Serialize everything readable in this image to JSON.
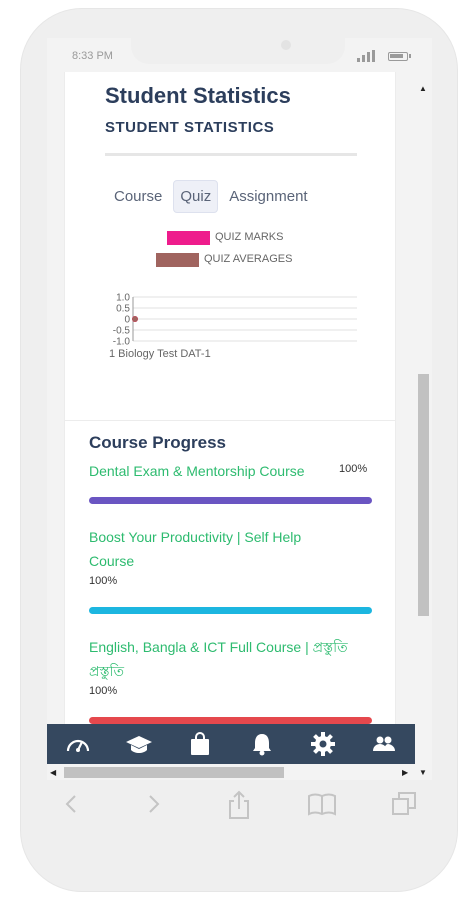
{
  "status_bar": {
    "time": "8:33 PM"
  },
  "stats_card": {
    "title": "Student Statistics",
    "subtitle": "STUDENT STATISTICS",
    "tabs": [
      {
        "label": "Course",
        "active": false
      },
      {
        "label": "Quiz",
        "active": true
      },
      {
        "label": "Assignment",
        "active": false
      }
    ]
  },
  "chart_data": {
    "type": "line",
    "legend": [
      {
        "label": "QUIZ MARKS",
        "color": "#ee1c8c"
      },
      {
        "label": "QUIZ AVERAGES",
        "color": "#a0645f"
      }
    ],
    "y_ticks": [
      "1.0",
      "0.5",
      "0",
      "-0.5",
      "-1.0"
    ],
    "ylim": [
      -1.0,
      1.0
    ],
    "categories": [
      "1 Biology Test DAT-1"
    ],
    "series": [
      {
        "name": "QUIZ MARKS",
        "values": [
          0
        ]
      },
      {
        "name": "QUIZ AVERAGES",
        "values": [
          0
        ]
      }
    ]
  },
  "progress_card": {
    "title": "Course Progress",
    "courses": [
      {
        "name": "Dental Exam & Mentorship Course",
        "percent_text": "100%",
        "progress": 1.0,
        "color": "#6a55c2"
      },
      {
        "name": "Boost Your Productivity | Self Help Course",
        "percent_text": "100%",
        "progress": 1.0,
        "color": "#1cb6e0"
      },
      {
        "name": "English, Bangla & ICT Full Course | প্রস্তুতি প্রস্তুতি",
        "percent_text": "100%",
        "progress": 1.0,
        "color": "#e5484d"
      }
    ]
  },
  "bottom_nav": {
    "icons": [
      "dashboard-gauge-icon",
      "graduation-cap-icon",
      "shopping-bag-icon",
      "bell-icon",
      "gear-icon",
      "users-icon"
    ]
  },
  "browser_bar": {
    "icons": [
      "back-icon",
      "forward-icon",
      "share-icon",
      "bookmarks-icon",
      "tabs-icon"
    ]
  }
}
